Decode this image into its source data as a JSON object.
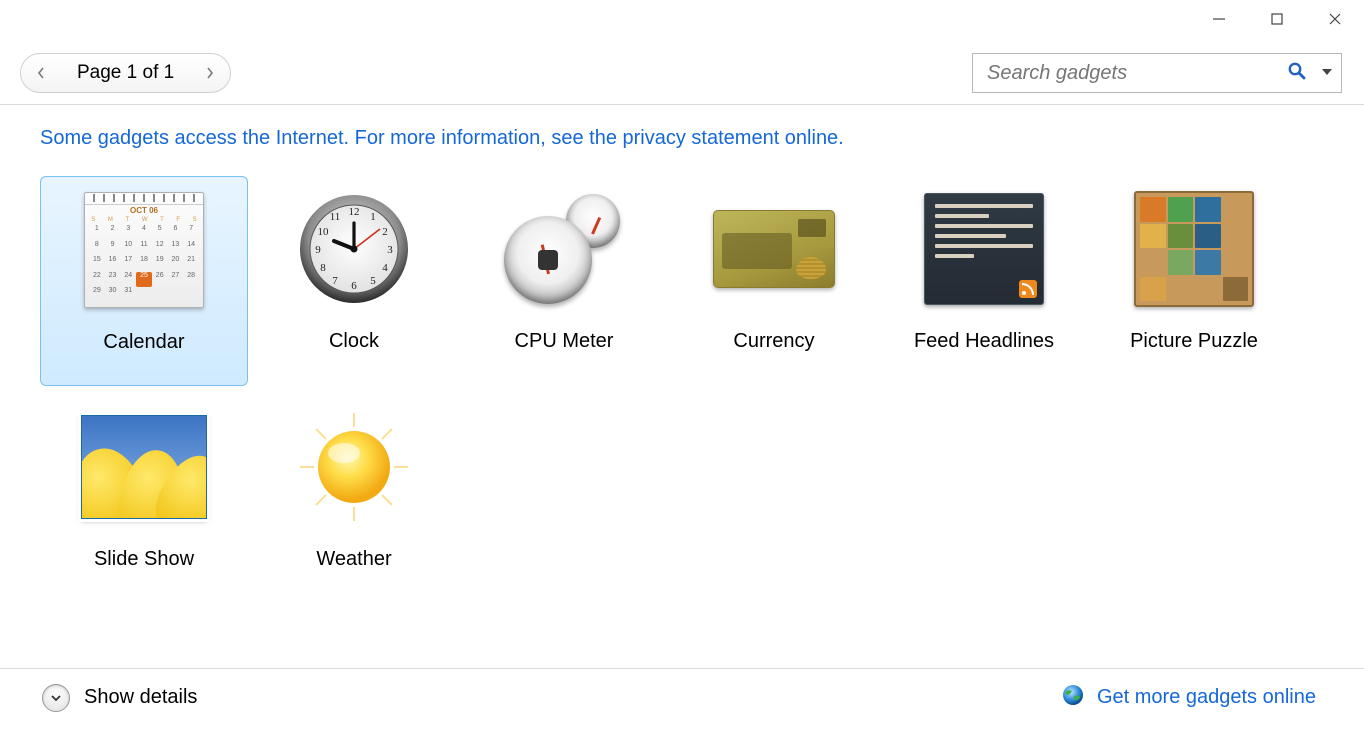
{
  "pager": {
    "label": "Page 1 of 1"
  },
  "search": {
    "placeholder": "Search gadgets"
  },
  "info_link": "Some gadgets access the Internet.  For more information, see the privacy statement online.",
  "gadgets": [
    {
      "name": "Calendar",
      "selected": true
    },
    {
      "name": "Clock",
      "selected": false
    },
    {
      "name": "CPU Meter",
      "selected": false
    },
    {
      "name": "Currency",
      "selected": false
    },
    {
      "name": "Feed Headlines",
      "selected": false
    },
    {
      "name": "Picture Puzzle",
      "selected": false
    },
    {
      "name": "Slide Show",
      "selected": false
    },
    {
      "name": "Weather",
      "selected": false
    }
  ],
  "footer": {
    "show_details": "Show details",
    "more_link": "Get more gadgets online"
  },
  "calendar_mock": {
    "month": "OCT 06",
    "dow": [
      "S",
      "M",
      "T",
      "W",
      "T",
      "F",
      "S"
    ],
    "start_offset": 0,
    "days": 31,
    "today": 25
  }
}
